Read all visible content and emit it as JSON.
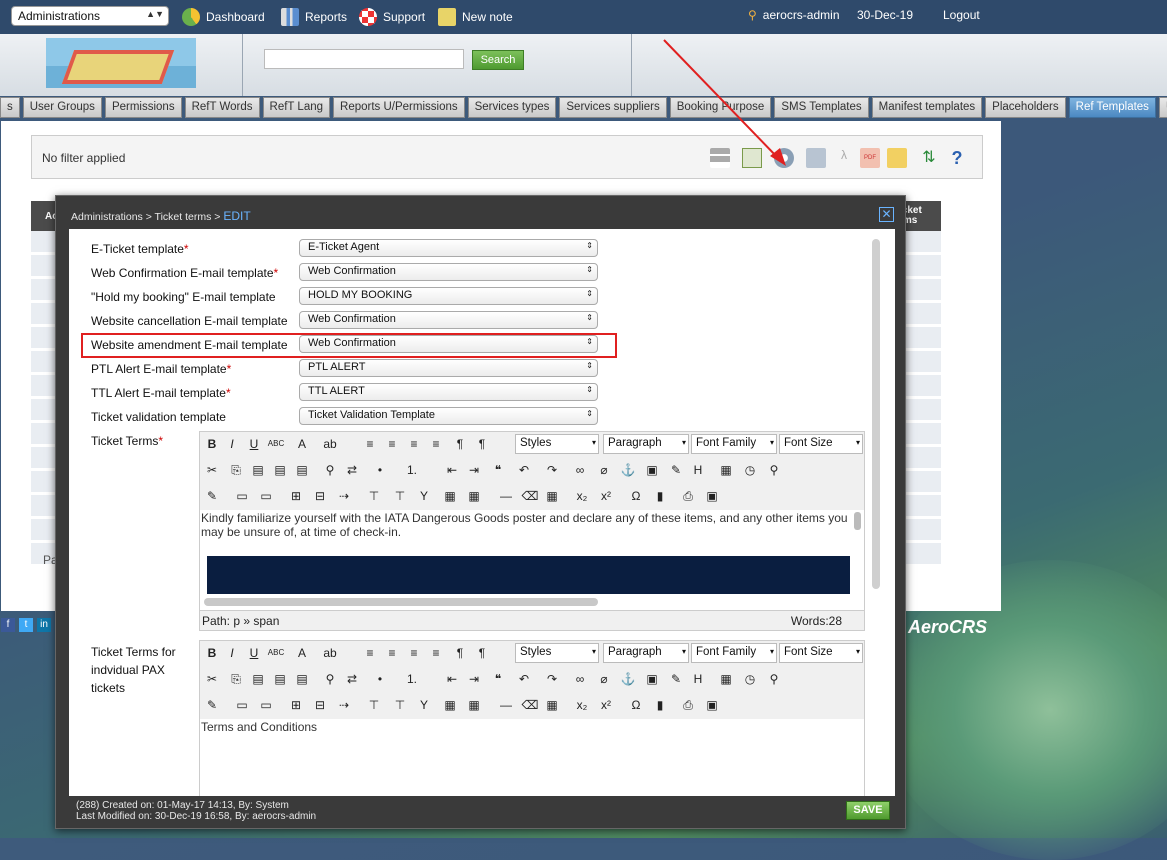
{
  "topbar": {
    "module_select": "Administrations",
    "nav": [
      {
        "label": "Dashboard",
        "icon": "dashboard-icon"
      },
      {
        "label": "Reports",
        "icon": "reports-icon"
      },
      {
        "label": "Support",
        "icon": "lifebuoy-icon"
      },
      {
        "label": "New note",
        "icon": "note-icon"
      }
    ],
    "user": "aerocrs-admin",
    "date": "30-Dec-19",
    "logout": "Logout"
  },
  "header": {
    "search_placeholder": "",
    "search_button": "Search"
  },
  "tabs": [
    {
      "label": "s",
      "active": false
    },
    {
      "label": "User Groups",
      "active": false
    },
    {
      "label": "Permissions",
      "active": false
    },
    {
      "label": "RefT Words",
      "active": false
    },
    {
      "label": "RefT Lang",
      "active": false
    },
    {
      "label": "Reports U/Permissions",
      "active": false
    },
    {
      "label": "Services types",
      "active": false
    },
    {
      "label": "Services suppliers",
      "active": false
    },
    {
      "label": "Booking Purpose",
      "active": false
    },
    {
      "label": "SMS Templates",
      "active": false
    },
    {
      "label": "Manifest templates",
      "active": false
    },
    {
      "label": "Placeholders",
      "active": false
    },
    {
      "label": "Ref Templates",
      "active": true
    },
    {
      "label": "Users",
      "active": false
    }
  ],
  "filter": {
    "text": "No filter applied"
  },
  "grid": {
    "header_left": "Ac",
    "header_right": "icket\nrms",
    "pager_label": "Pa"
  },
  "modal": {
    "breadcrumb": "Administrations > Ticket terms > ",
    "breadcrumb_edit": "EDIT",
    "fields": [
      {
        "label": "E-Ticket template",
        "required": true,
        "value": "E-Ticket Agent"
      },
      {
        "label": "Web Confirmation E-mail template",
        "required": true,
        "value": "Web Confirmation"
      },
      {
        "label": "\"Hold my booking\" E-mail template",
        "required": false,
        "value": "HOLD MY BOOKING"
      },
      {
        "label": "Website cancellation E-mail template",
        "required": false,
        "value": "Web Confirmation"
      },
      {
        "label": "Website amendment E-mail template",
        "required": false,
        "value": "Web Confirmation"
      },
      {
        "label": "PTL Alert E-mail template",
        "required": true,
        "value": "PTL ALERT"
      },
      {
        "label": "TTL Alert E-mail template",
        "required": true,
        "value": "TTL ALERT"
      },
      {
        "label": "Ticket validation template",
        "required": false,
        "value": "Ticket Validation Template"
      }
    ],
    "editor1": {
      "label": "Ticket Terms",
      "required": true,
      "styles": "Styles",
      "format": "Paragraph",
      "font_family": "Font Family",
      "font_size": "Font Size",
      "content": "Kindly familiarize yourself with the IATA Dangerous Goods poster and declare any of these items, and any other items you may be unsure of, at time of check-in.",
      "path": "Path: p » span",
      "words": "Words:28"
    },
    "editor2": {
      "label": "Ticket Terms for indvidual PAX tickets",
      "styles": "Styles",
      "format": "Paragraph",
      "font_family": "Font Family",
      "font_size": "Font Size",
      "content": "Terms and Conditions"
    },
    "footer_created": "(288) Created on: 01-May-17 14:13, By: System",
    "footer_modified": "Last Modified on: 30-Dec-19 16:58, By: aerocrs-admin",
    "save": "SAVE"
  },
  "brand": "AeroCRS",
  "colors": {
    "accent": "#4b88c2",
    "save": "#4f9a2e",
    "highlight": "#e02020",
    "editor_dark": "#0a1e40"
  }
}
